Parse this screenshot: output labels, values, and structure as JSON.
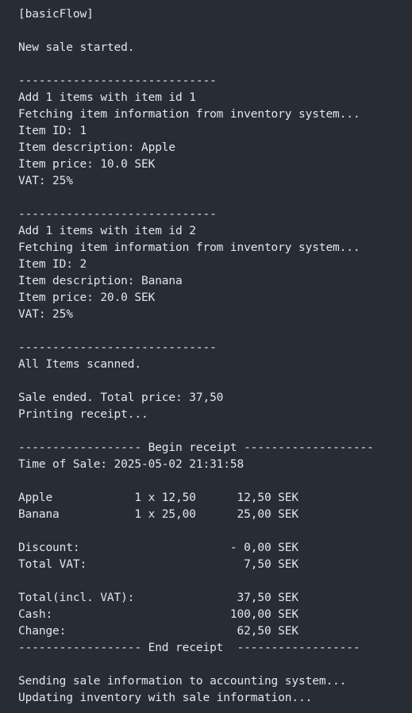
{
  "colors": {
    "background": "#282c34",
    "text": "#e3e6ea"
  },
  "console": {
    "lines": [
      "[basicFlow]",
      "",
      "New sale started.",
      "",
      "-----------------------------",
      "Add 1 items with item id 1",
      "Fetching item information from inventory system...",
      "Item ID: 1",
      "Item description: Apple",
      "Item price: 10.0 SEK",
      "VAT: 25%",
      "",
      "-----------------------------",
      "Add 1 items with item id 2",
      "Fetching item information from inventory system...",
      "Item ID: 2",
      "Item description: Banana",
      "Item price: 20.0 SEK",
      "VAT: 25%",
      "",
      "-----------------------------",
      "All Items scanned.",
      "",
      "Sale ended. Total price: 37,50",
      "Printing receipt...",
      "",
      "------------------ Begin receipt -------------------",
      "Time of Sale: 2025-05-02 21:31:58",
      "",
      "Apple            1 x 12,50      12,50 SEK",
      "Banana           1 x 25,00      25,00 SEK",
      "",
      "Discount:                      - 0,00 SEK",
      "Total VAT:                       7,50 SEK",
      "",
      "Total(incl. VAT):               37,50 SEK",
      "Cash:                          100,00 SEK",
      "Change:                         62,50 SEK",
      "------------------ End receipt  ------------------",
      "",
      "Sending sale information to accounting system...",
      "Updating inventory with sale information..."
    ]
  }
}
